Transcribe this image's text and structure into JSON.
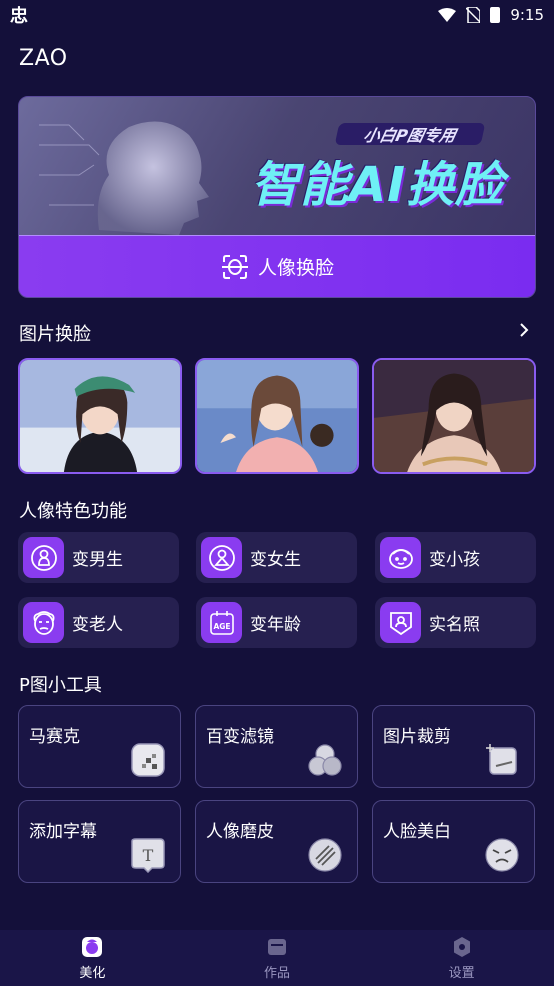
{
  "status_bar": {
    "left_glyph": "忠",
    "time": "9:15"
  },
  "app": {
    "title": "ZAO"
  },
  "hero": {
    "tag": "小白P图专用",
    "title": "智能AI换脸",
    "button_label": "人像换脸"
  },
  "photo_section": {
    "title": "图片换脸"
  },
  "portrait_section": {
    "title": "人像特色功能",
    "items": [
      {
        "label": "变男生",
        "icon": "male-person-icon"
      },
      {
        "label": "变女生",
        "icon": "female-person-icon"
      },
      {
        "label": "变小孩",
        "icon": "child-face-icon"
      },
      {
        "label": "变老人",
        "icon": "elder-face-icon"
      },
      {
        "label": "变年龄",
        "icon": "age-calendar-icon"
      },
      {
        "label": "实名照",
        "icon": "id-photo-icon"
      }
    ]
  },
  "tools_section": {
    "title": "P图小工具",
    "items": [
      {
        "label": "马赛克",
        "icon": "mosaic-icon"
      },
      {
        "label": "百变滤镜",
        "icon": "filter-icon"
      },
      {
        "label": "图片裁剪",
        "icon": "crop-icon"
      },
      {
        "label": "添加字幕",
        "icon": "subtitle-icon"
      },
      {
        "label": "人像磨皮",
        "icon": "smooth-skin-icon"
      },
      {
        "label": "人脸美白",
        "icon": "whiten-face-icon"
      }
    ]
  },
  "bottom_nav": {
    "items": [
      {
        "label": "美化",
        "icon": "beautify-icon",
        "active": true
      },
      {
        "label": "作品",
        "icon": "works-icon",
        "active": false
      },
      {
        "label": "设置",
        "icon": "settings-icon",
        "active": false
      }
    ]
  },
  "colors": {
    "background": "#14103a",
    "accent": "#8a3cf0",
    "card": "#262050",
    "title_cyan": "#6ff0f5"
  }
}
